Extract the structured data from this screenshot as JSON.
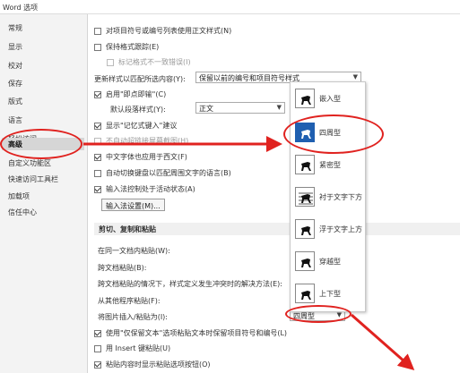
{
  "window": {
    "title": "Word 选项"
  },
  "sidebar": {
    "items": [
      {
        "label": "常规"
      },
      {
        "label": "显示"
      },
      {
        "label": "校对"
      },
      {
        "label": "保存"
      },
      {
        "label": "版式"
      },
      {
        "label": "语言"
      },
      {
        "label": "轻松访问"
      },
      {
        "label": "高级"
      },
      {
        "label": "自定义功能区"
      },
      {
        "label": "快速访问工具栏"
      },
      {
        "label": "加载项"
      },
      {
        "label": "信任中心"
      }
    ]
  },
  "options": {
    "normal_style_numbering": "对项目符号或编号列表使用正文样式(N)",
    "track_formatting": "保持格式跟踪(E)",
    "mark_inconsistency": "标记格式不一致错误(I)",
    "update_style_label": "更新样式以匹配所选内容(Y):",
    "update_style_value": "保留以前的编号和项目符号样式",
    "click_and_type": "启用\"即点即输\"(C)",
    "default_para_label": "默认段落样式(Y):",
    "default_para_value": "正文",
    "autocomplete": "显示\"记忆式键入\"建议",
    "no_auto_hyperlink": "不自动超链接屏幕截图(H)",
    "cjk_font_english": "中文字体也应用于西文(F)",
    "auto_keyboard": "自动切换键盘以匹配周围文字的语言(B)",
    "ime_control": "输入法控制处于活动状态(A)",
    "ime_settings_button": "输入法设置(M)..."
  },
  "paste_section": {
    "title": "剪切、复制和粘贴",
    "same_doc": "在同一文档内粘贴(W):",
    "cross_doc": "跨文档粘贴(B):",
    "cross_doc_conflict": "跨文档粘贴的情况下，样式定义发生冲突时的解决方法(E):",
    "from_other": "从其他程序粘贴(F):",
    "insert_picture_label": "将图片插入/粘贴为(I):",
    "insert_picture_value": "四周型",
    "keep_bullets": "使用\"仅保留文本\"选项粘贴文本时保留项目符号和编号(L)",
    "use_insert_key": "用 Insert 键粘贴(U)",
    "show_paste_options": "粘贴内容时显示粘贴选项按钮(O)"
  },
  "wrap_dropdown": {
    "items": [
      {
        "label": "嵌入型",
        "icon": "inline-icon"
      },
      {
        "label": "四周型",
        "icon": "square-wrap-icon"
      },
      {
        "label": "紧密型",
        "icon": "tight-wrap-icon"
      },
      {
        "label": "衬于文字下方",
        "icon": "behind-text-icon"
      },
      {
        "label": "浮于文字上方",
        "icon": "in-front-text-icon"
      },
      {
        "label": "穿越型",
        "icon": "through-wrap-icon"
      },
      {
        "label": "上下型",
        "icon": "top-bottom-wrap-icon"
      }
    ]
  },
  "colors": {
    "annotation": "#e0221f",
    "selected": "#1f5fb0"
  }
}
